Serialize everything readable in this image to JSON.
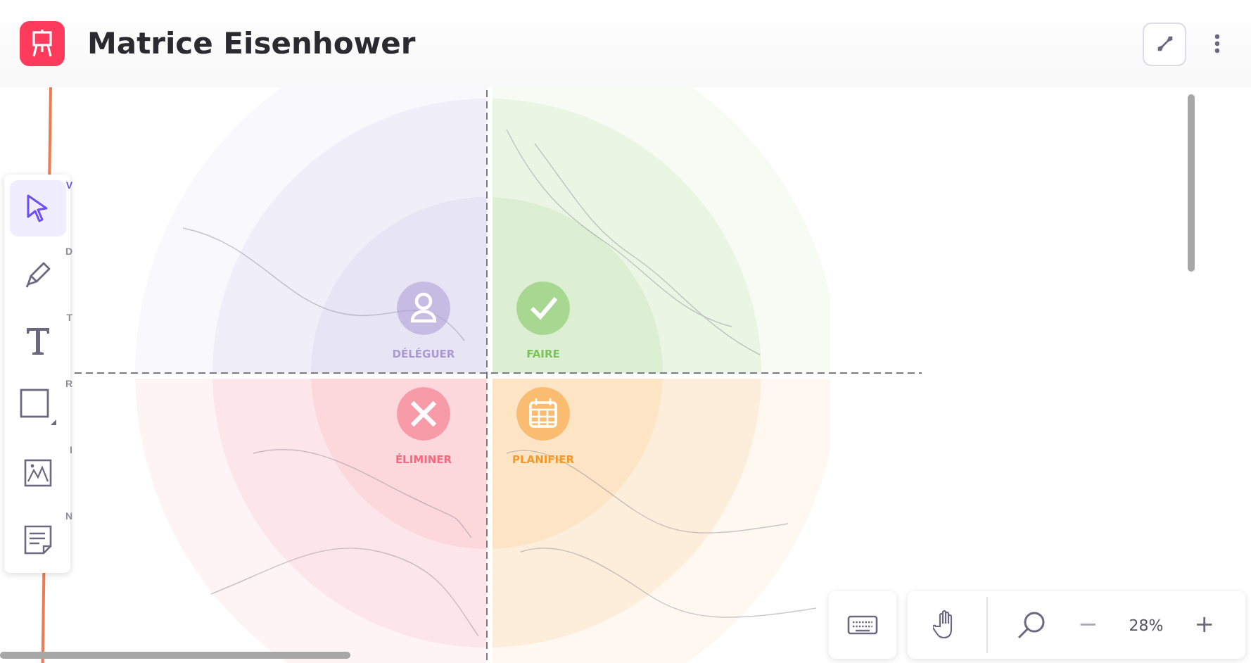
{
  "window": {
    "title": "Matrice Eisenhower"
  },
  "tools": [
    {
      "kind": "select",
      "shortcut": "V",
      "selected": true
    },
    {
      "kind": "pencil",
      "shortcut": "D",
      "selected": false
    },
    {
      "kind": "text",
      "shortcut": "T",
      "selected": false
    },
    {
      "kind": "shape",
      "shortcut": "R",
      "selected": false
    },
    {
      "kind": "image",
      "shortcut": "I",
      "selected": false
    },
    {
      "kind": "note",
      "shortcut": "N",
      "selected": false
    }
  ],
  "quadrants": [
    {
      "kind": "user",
      "label": "DÉLÉGUER",
      "color": "#a99ad6"
    },
    {
      "kind": "check",
      "label": "FAIRE",
      "color": "#7cc35a"
    },
    {
      "kind": "cross",
      "label": "ÉLIMINER",
      "color": "#f46a7e"
    },
    {
      "kind": "calendar",
      "label": "PLANIFIER",
      "color": "#f59a2a"
    }
  ],
  "zoom": {
    "minus": "−",
    "value": "28%",
    "plus": "+"
  }
}
